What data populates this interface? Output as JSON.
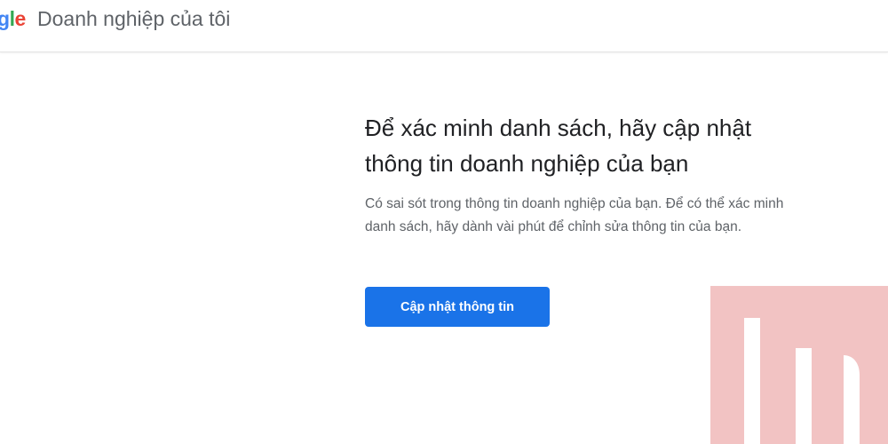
{
  "header": {
    "logo_parts": [
      "g",
      "l",
      "e"
    ],
    "product_name": "Doanh nghiệp của tôi"
  },
  "main": {
    "title": "Để xác minh danh sách, hãy cập nhật thông tin doanh nghiệp của bạn",
    "description": "Có sai sót trong thông tin doanh nghiệp của bạn. Để có thể xác minh danh sách, hãy dành vài phút để chỉnh sửa thông tin của bạn.",
    "button_label": "Cập nhật thông tin"
  },
  "colors": {
    "button": "#1a73e8",
    "watermark": "#f2c3c3",
    "title_text": "#202124",
    "body_text": "#5f6368"
  },
  "watermark_icon": "brand-watermark-icon"
}
